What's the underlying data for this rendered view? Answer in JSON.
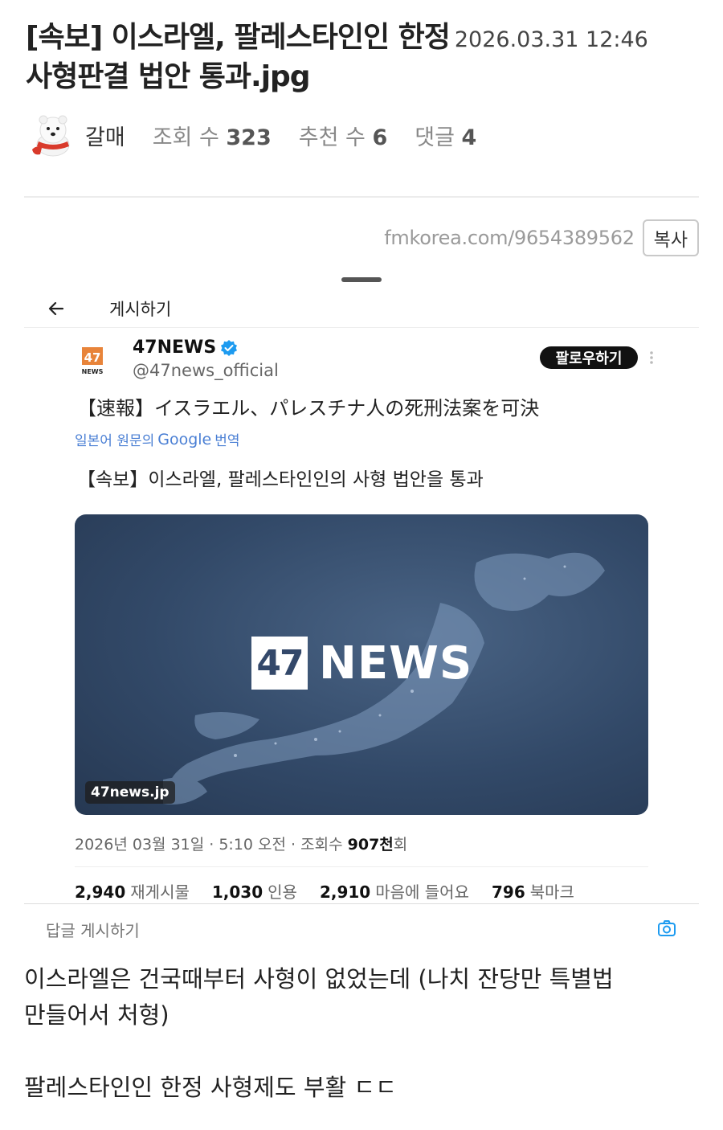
{
  "post": {
    "title_line1": "[속보] 이스라엘, 팔레스타인인 한정",
    "date": "2026.03.31 12:46",
    "title_line2": "사형판결 법안 통과.jpg",
    "author": "갈매",
    "views_label": "조회 수",
    "views": "323",
    "likes_label": "추천 수",
    "likes": "6",
    "comments_label": "댓글",
    "comments": "4",
    "url": "fmkorea.com/9654389562",
    "copy_label": "복사"
  },
  "screenshot": {
    "header_label": "게시하기",
    "account": {
      "logo_number": "47",
      "logo_small": "NEWS",
      "name": "47NEWS",
      "handle": "@47news_official",
      "follow_label": "팔로우하기"
    },
    "text_jp": "【速報】イスラエル、パレスチナ人の死刑法案を可決",
    "translate_prefix": "일본어 원문의",
    "translate_brand": "Google",
    "translate_suffix": "번역",
    "text_ko": "【속보】이스라엘, 팔레스타인인의 사형 법안을 통과",
    "media": {
      "logo_number": "47",
      "logo_word": "NEWS",
      "domain": "47news.jp"
    },
    "timestamp": "2026년 03월 31일 · 5:10 오전 · 조회수 ",
    "view_count": "907천",
    "view_suffix": "회",
    "stats": [
      {
        "count": "2,940",
        "label": "재게시물"
      },
      {
        "count": "1,030",
        "label": "인용"
      },
      {
        "count": "2,910",
        "label": "마음에 들어요"
      },
      {
        "count": "796",
        "label": "북마크"
      }
    ],
    "reply_placeholder": "답글 게시하기"
  },
  "body": {
    "line1": "이스라엘은 건국때부터 사형이 없었는데 (나치 잔당만 특별법",
    "line2": "만들어서 처형)",
    "line3": "팔레스타인인 한정 사형제도 부활 ㄷㄷ"
  },
  "colors": {
    "link_blue": "#4a7fd4",
    "verified_blue": "#1d9bf0",
    "follow_bg": "#111111",
    "logo_orange": "#e8843a",
    "media_bg": "#324968"
  },
  "icons": [
    "avatar-polar-bear",
    "back-arrow-icon",
    "verified-badge-icon",
    "more-dots-icon",
    "camera-icon"
  ]
}
